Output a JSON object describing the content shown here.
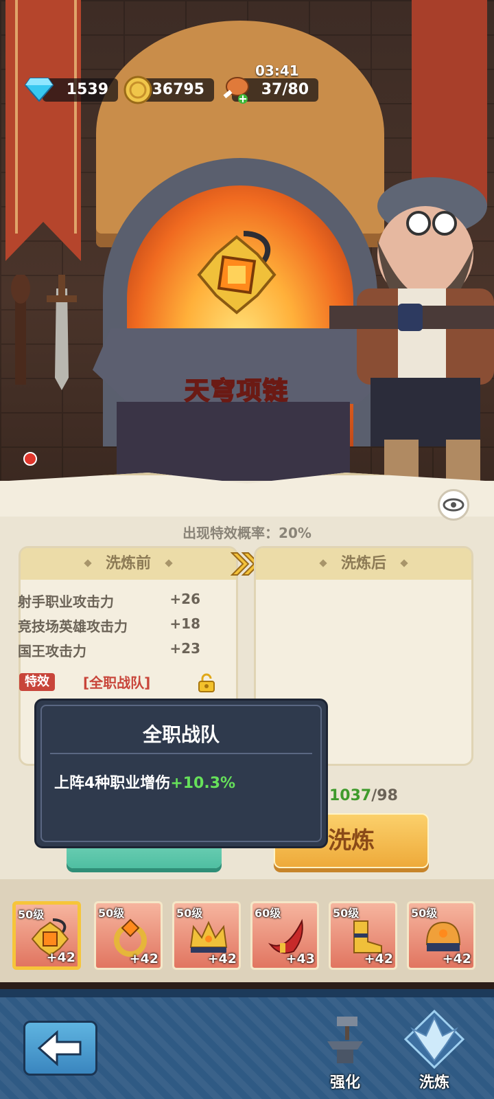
{
  "hud": {
    "gems": "1539",
    "coins": "36795",
    "stamina": "37/80",
    "timer": "03:41"
  },
  "forge": {
    "item_name": "天穹项链"
  },
  "panel": {
    "special_rate": "出现特效概率：20%",
    "before_title": "洗炼前",
    "after_title": "洗炼后",
    "stats": [
      {
        "name": "射手职业攻击力",
        "value": "+26"
      },
      {
        "name": "竞技场英雄攻击力",
        "value": "+18"
      },
      {
        "name": "国王攻击力",
        "value": "+23"
      }
    ],
    "special_tag": "特效",
    "special_name": "[全职战队]"
  },
  "tooltip": {
    "title": "全职战队",
    "desc_prefix": "上阵4种职业增伤",
    "desc_value": "+10.3%"
  },
  "cost": {
    "have": "1037",
    "need": "/98"
  },
  "buttons": {
    "refine": "洗炼"
  },
  "equipment": [
    {
      "level": "50级",
      "plus": "+42",
      "icon": "amulet-icon",
      "selected": true
    },
    {
      "level": "50级",
      "plus": "+42",
      "icon": "ring-icon"
    },
    {
      "level": "50级",
      "plus": "+42",
      "icon": "crown-icon"
    },
    {
      "level": "60级",
      "plus": "+43",
      "icon": "horn-icon"
    },
    {
      "level": "50级",
      "plus": "+42",
      "icon": "boots-icon"
    },
    {
      "level": "50级",
      "plus": "+42",
      "icon": "helmet-icon"
    }
  ],
  "nav": {
    "enhance": "强化",
    "refine": "洗炼"
  },
  "colors": {
    "accent_green": "#66e05a",
    "special_red": "#c8453a",
    "refine_button": "#eeaa3a",
    "nav_blue": "#2f5a84"
  }
}
